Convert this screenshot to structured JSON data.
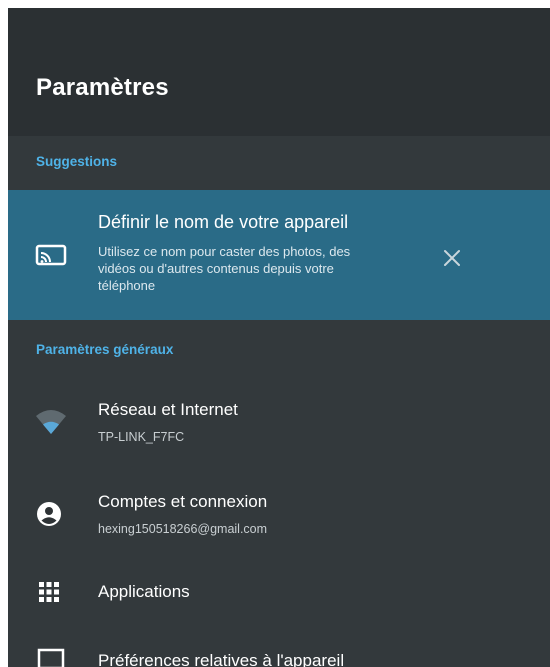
{
  "header": {
    "title": "Paramètres"
  },
  "suggestions": {
    "section_label": "Suggestions",
    "card": {
      "icon": "cast-icon",
      "title": "Définir le nom de votre appareil",
      "description_lines": [
        "Utilisez ce nom pour caster des photos, des",
        "vidéos ou d'autres contenus depuis votre",
        "téléphone"
      ],
      "dismiss_icon": "close-icon"
    }
  },
  "general": {
    "section_label": "Paramètres généraux",
    "items": [
      {
        "icon": "wifi-icon",
        "title": "Réseau et Internet",
        "subtitle": "TP-LINK_F7FC"
      },
      {
        "icon": "account-icon",
        "title": "Comptes et connexion",
        "subtitle": "hexing150518266@gmail.com"
      },
      {
        "icon": "apps-grid-icon",
        "title": "Applications"
      },
      {
        "icon": "tv-icon",
        "title": "Préférences relatives à l'appareil"
      }
    ]
  },
  "colors": {
    "panel_bg": "#33393c",
    "header_bg": "#2b3033",
    "accent": "#4fb3e8",
    "card_bg": "#2a6b87",
    "wifi_signal": "#5aa8d8"
  }
}
